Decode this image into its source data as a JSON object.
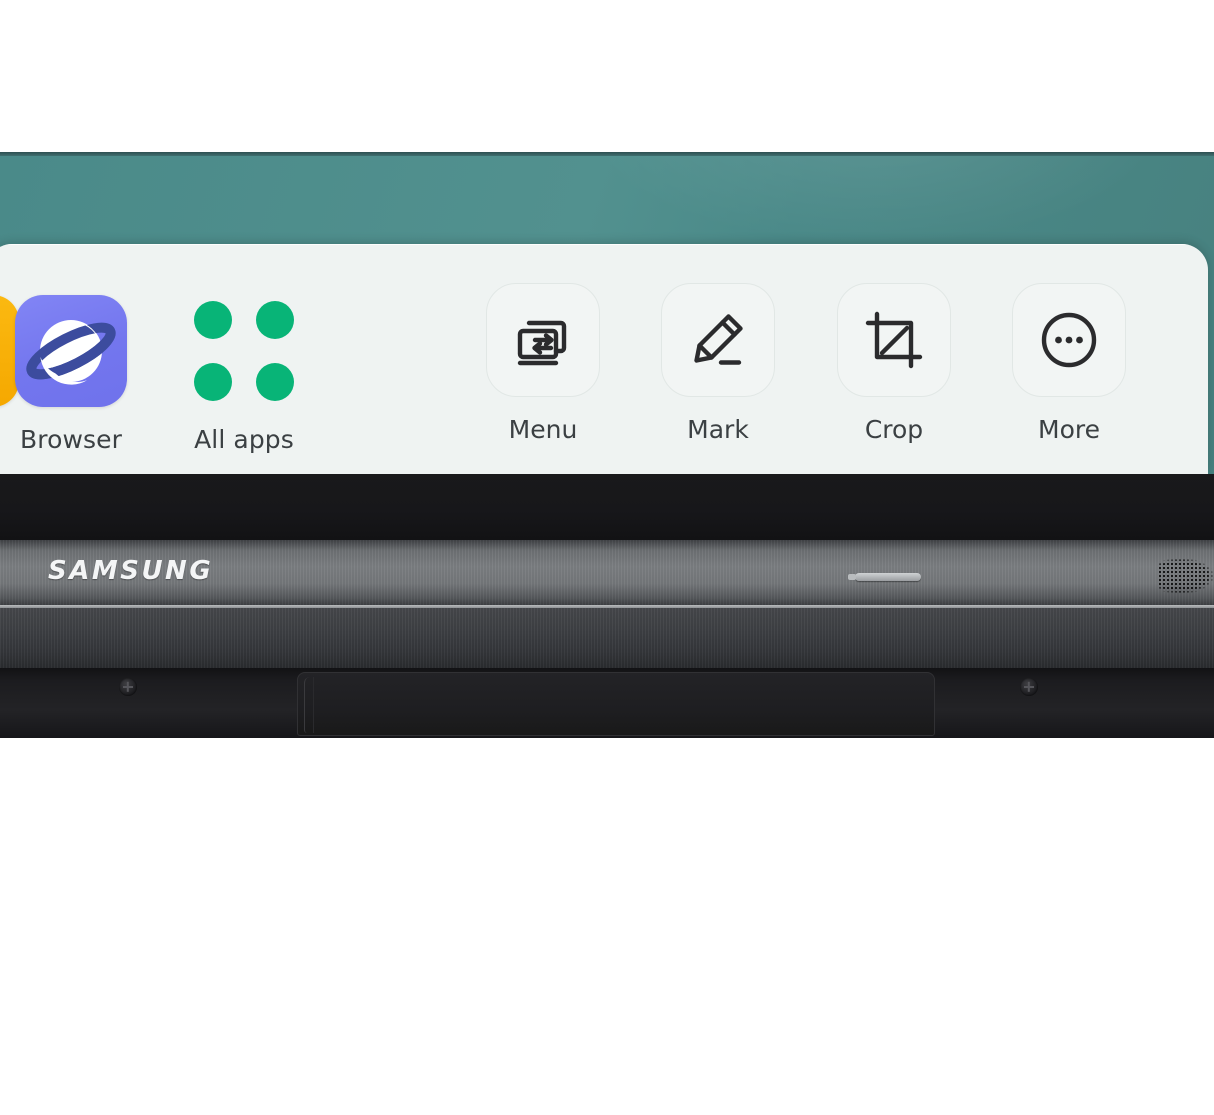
{
  "device": {
    "brand_logo": "SAMSUNG",
    "bezel_elements": {
      "stylus_slot": "stylus-slot",
      "speaker_grille": "speaker-grille",
      "screw_left": "screw",
      "screw_right": "screw",
      "bottom_panel": "bezel-panel"
    },
    "wallpaper_color": "#4d8c8b"
  },
  "toolbar": {
    "background_color": "#eff3f2",
    "collapse_icon": "chevron-double-down-icon",
    "divider": "vertical-divider",
    "home_indicator": "home-indicator-partial",
    "apps": [
      {
        "id": "orange-app",
        "label": "",
        "icon": "orange-app-icon",
        "color": "#f5a800",
        "partially_visible": true
      },
      {
        "id": "browser",
        "label": "Browser",
        "icon": "samsung-internet-planet-icon",
        "color": "#7376ee"
      },
      {
        "id": "all-apps",
        "label": "All apps",
        "icon": "four-dots-grid-icon",
        "color": "#08b477"
      }
    ],
    "tools": [
      {
        "id": "menu",
        "label": "Menu",
        "icon": "source-switch-screens-icon"
      },
      {
        "id": "mark",
        "label": "Mark",
        "icon": "pencil-marker-icon"
      },
      {
        "id": "crop",
        "label": "Crop",
        "icon": "crop-frame-icon"
      },
      {
        "id": "more",
        "label": "More",
        "icon": "circle-ellipsis-icon"
      }
    ]
  }
}
